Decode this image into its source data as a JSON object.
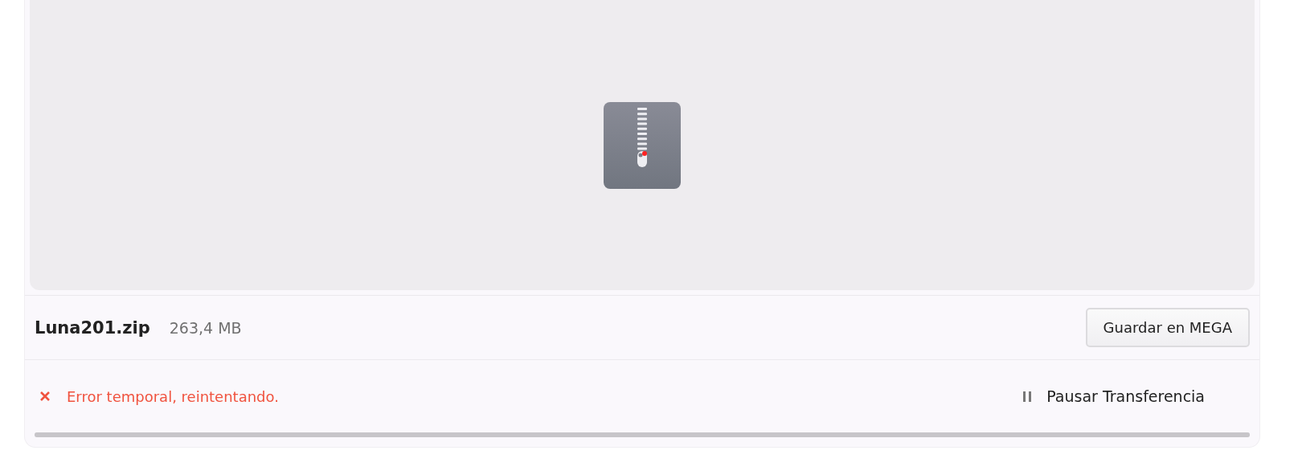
{
  "file": {
    "name": "Luna201.zip",
    "size": "263,4 MB",
    "kind": "zip"
  },
  "save_button": {
    "label": "Guardar en MEGA"
  },
  "status": {
    "kind": "error",
    "message": "Error temporal, reintentando."
  },
  "pause_button": {
    "label": "Pausar Transferencia"
  },
  "progress": {
    "level": 1
  }
}
